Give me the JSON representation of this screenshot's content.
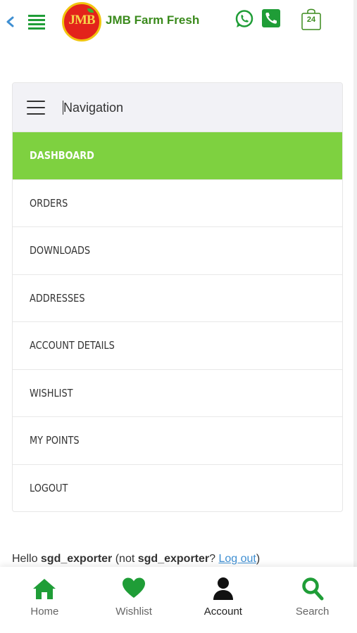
{
  "header": {
    "brand": "JMB Farm Fresh",
    "logo_text": "JMB",
    "cart_count": "24",
    "icons": [
      "chevron-left-icon",
      "hamburger-menu-icon",
      "whatsapp-icon",
      "phone-icon",
      "shopping-bag-icon"
    ]
  },
  "nav": {
    "title": "Navigation",
    "items": [
      {
        "label": "DASHBOARD",
        "active": true
      },
      {
        "label": "ORDERS",
        "active": false
      },
      {
        "label": "DOWNLOADS",
        "active": false
      },
      {
        "label": "ADDRESSES",
        "active": false
      },
      {
        "label": "ACCOUNT DETAILS",
        "active": false
      },
      {
        "label": "WISHLIST",
        "active": false
      },
      {
        "label": "MY POINTS",
        "active": false
      },
      {
        "label": "LOGOUT",
        "active": false
      }
    ]
  },
  "greeting": {
    "hello": "Hello ",
    "username": "sgd_exporter",
    "not_open": " (not ",
    "username2": "sgd_exporter",
    "question": "? ",
    "logout_link": "Log out",
    "close": ")"
  },
  "bottom_nav": {
    "tabs": [
      {
        "label": "Home",
        "icon": "home-icon"
      },
      {
        "label": "Wishlist",
        "icon": "heart-icon"
      },
      {
        "label": "Account",
        "icon": "user-icon"
      },
      {
        "label": "Search",
        "icon": "search-icon"
      }
    ]
  },
  "colors": {
    "brand_green": "#3a8a1c",
    "active_green": "#7ed140",
    "icon_green": "#1f9d37",
    "link_blue": "#3f8fd2",
    "logo_red": "#e3231b"
  }
}
